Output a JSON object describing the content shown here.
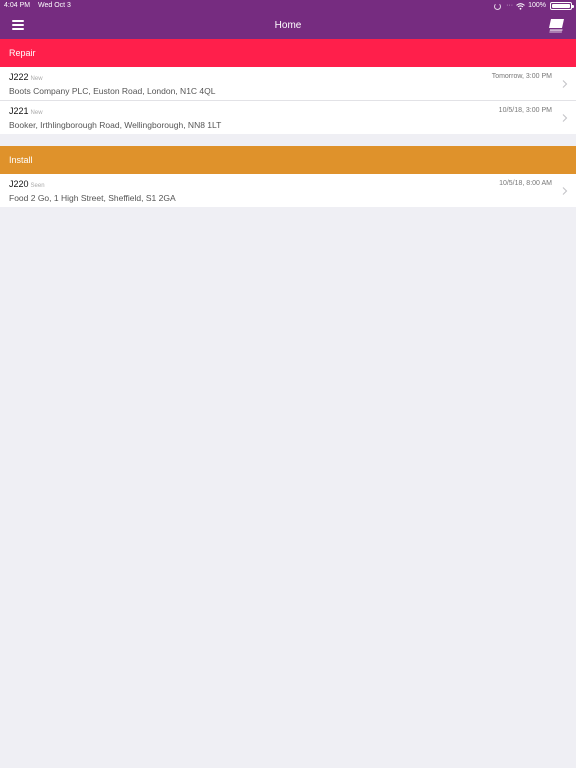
{
  "status_bar": {
    "time": "4:04 PM",
    "date": "Wed Oct 3",
    "battery": "100%"
  },
  "nav": {
    "title": "Home",
    "menu_icon": "hamburger-menu-icon",
    "right_icon": "stack-icon"
  },
  "colors": {
    "nav": "#762c80",
    "repair": "#ff1f4b",
    "install": "#df922b",
    "background": "#efeff4"
  },
  "sections": [
    {
      "title": "Repair",
      "jobs": [
        {
          "id": "J222",
          "status": "New",
          "time": "Tomorrow, 3:00 PM",
          "address": "Boots Company PLC, Euston Road, London, N1C 4QL"
        },
        {
          "id": "J221",
          "status": "New",
          "time": "10/5/18, 3:00 PM",
          "address": "Booker, Irthlingborough Road, Wellingborough, NN8 1LT"
        }
      ]
    },
    {
      "title": "Install",
      "jobs": [
        {
          "id": "J220",
          "status": "Seen",
          "time": "10/5/18, 8:00 AM",
          "address": "Food 2 Go, 1 High Street, Sheffield, S1 2GA"
        }
      ]
    }
  ]
}
